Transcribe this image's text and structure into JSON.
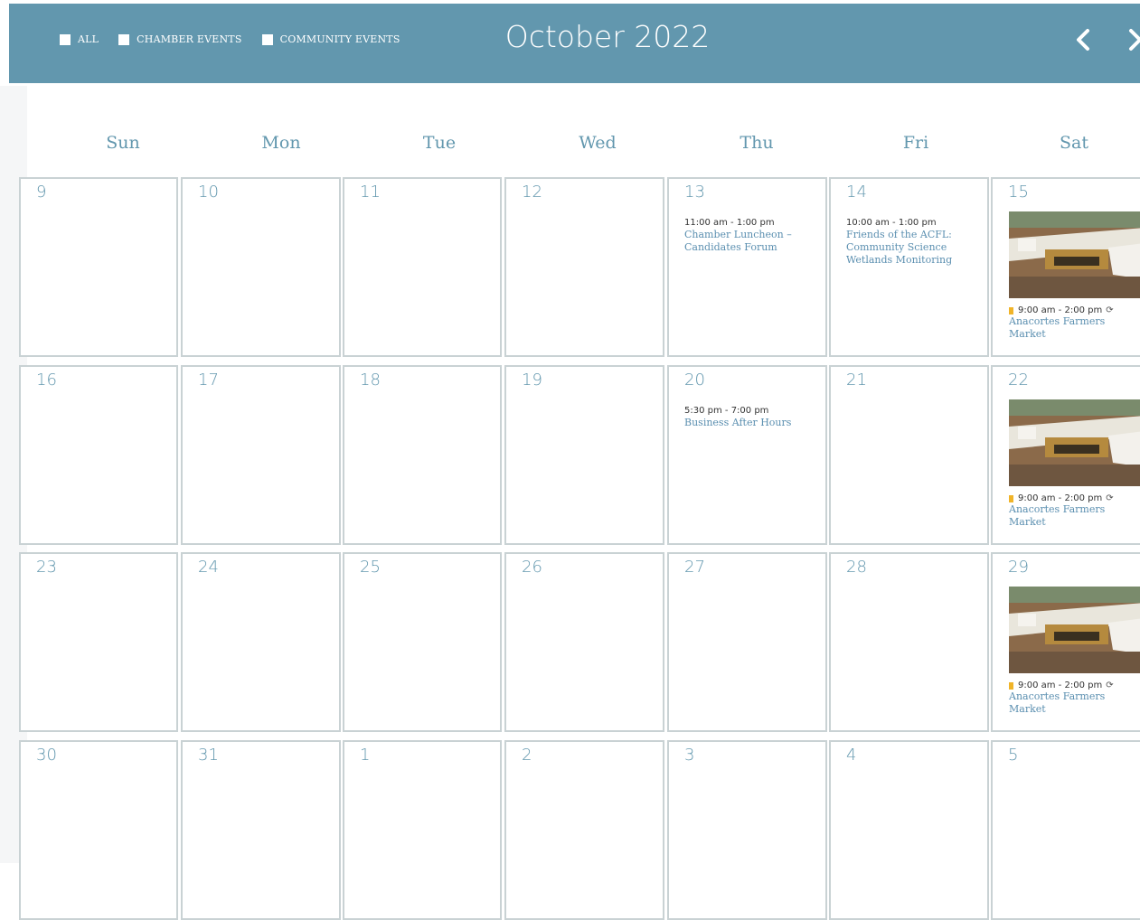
{
  "header": {
    "filters": [
      "ALL",
      "CHAMBER EVENTS",
      "COMMUNITY EVENTS"
    ],
    "month_title": "October 2022",
    "prev_icon": "chevron-left-icon",
    "next_icon": "chevron-right-icon"
  },
  "weekdays": [
    "Sun",
    "Mon",
    "Tue",
    "Wed",
    "Thu",
    "Fri",
    "Sat"
  ],
  "weeks": [
    [
      "9",
      "10",
      "11",
      "12",
      "13",
      "14",
      "15"
    ],
    [
      "16",
      "17",
      "18",
      "19",
      "20",
      "21",
      "22"
    ],
    [
      "23",
      "24",
      "25",
      "26",
      "27",
      "28",
      "29"
    ],
    [
      "30",
      "31",
      "1",
      "2",
      "3",
      "4",
      "5"
    ]
  ],
  "events": {
    "thu13": {
      "time": "11:00 am - 1:00 pm",
      "title": "Chamber Luncheon – Candidates Forum"
    },
    "fri14": {
      "time": "10:00 am - 1:00 pm",
      "title": "Friends of the ACFL: Community Science Wetlands Monitoring"
    },
    "thu20": {
      "time": "5:30 pm - 7:00 pm",
      "title": "Business After Hours"
    },
    "market": {
      "time": "9:00 am - 2:00 pm",
      "title": "Anacortes Farmers Market",
      "repeat_icon": "repeat-icon",
      "flag_color": "#f0b429"
    }
  },
  "colors": {
    "header": "#6297ae",
    "accent": "#6297ae",
    "cell_border": "#c9d2d4",
    "link": "#5b8fb0"
  }
}
